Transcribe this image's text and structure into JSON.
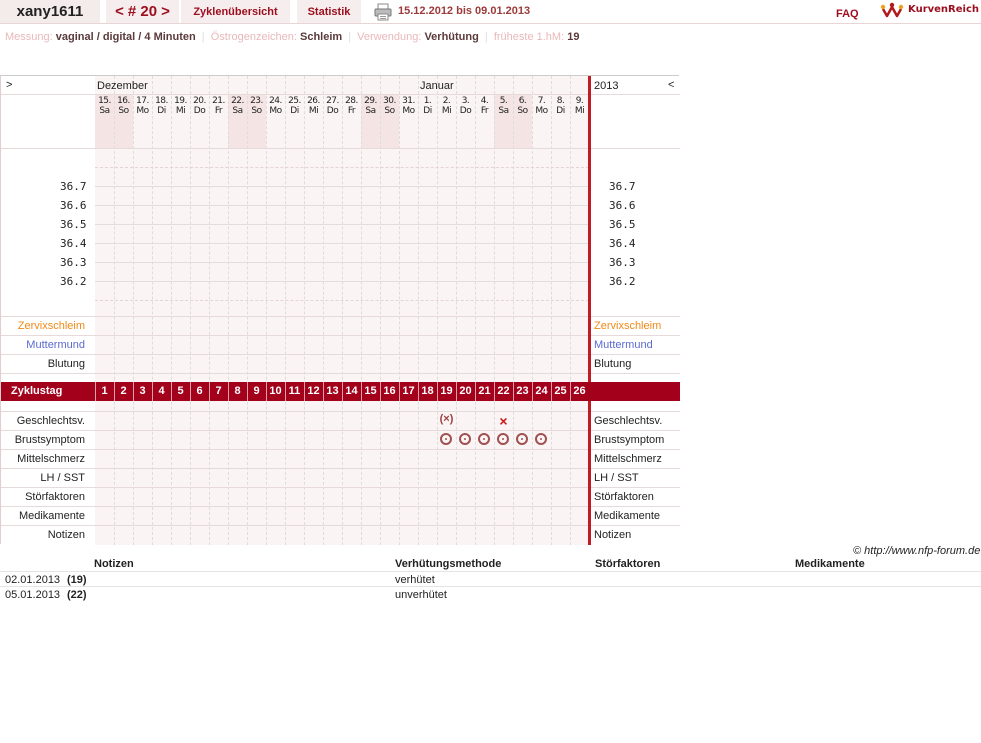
{
  "header": {
    "username": "xany1611",
    "cycle_prev": "<",
    "cycle_label": "# 20",
    "cycle_next": ">",
    "tab_overview": "Zyklenübersicht",
    "tab_stats": "Statistik",
    "date_range": "15.12.2012 bis 09.01.2013",
    "faq": "FAQ",
    "brand": "KurvenReich"
  },
  "info": {
    "measurement_label": "Messung:",
    "measurement_value": "vaginal / digital / 4 Minuten",
    "estrogen_label": "Östrogenzeichen:",
    "estrogen_value": "Schleim",
    "usage_label": "Verwendung:",
    "usage_value": "Verhütung",
    "earliest_label": "früheste 1.hM:",
    "earliest_value": "19"
  },
  "chart": {
    "nav_left": ">",
    "nav_right": "<",
    "month_dec": "Dezember",
    "month_jan": "Januar",
    "year": "2013",
    "days": [
      {
        "d": "15.",
        "w": "Sa"
      },
      {
        "d": "16.",
        "w": "So"
      },
      {
        "d": "17.",
        "w": "Mo"
      },
      {
        "d": "18.",
        "w": "Di"
      },
      {
        "d": "19.",
        "w": "Mi"
      },
      {
        "d": "20.",
        "w": "Do"
      },
      {
        "d": "21.",
        "w": "Fr"
      },
      {
        "d": "22.",
        "w": "Sa"
      },
      {
        "d": "23.",
        "w": "So"
      },
      {
        "d": "24.",
        "w": "Mo"
      },
      {
        "d": "25.",
        "w": "Di"
      },
      {
        "d": "26.",
        "w": "Mi"
      },
      {
        "d": "27.",
        "w": "Do"
      },
      {
        "d": "28.",
        "w": "Fr"
      },
      {
        "d": "29.",
        "w": "Sa"
      },
      {
        "d": "30.",
        "w": "So"
      },
      {
        "d": "31.",
        "w": "Mo"
      },
      {
        "d": "1.",
        "w": "Di"
      },
      {
        "d": "2.",
        "w": "Mi"
      },
      {
        "d": "3.",
        "w": "Do"
      },
      {
        "d": "4.",
        "w": "Fr"
      },
      {
        "d": "5.",
        "w": "Sa"
      },
      {
        "d": "6.",
        "w": "So"
      },
      {
        "d": "7.",
        "w": "Mo"
      },
      {
        "d": "8.",
        "w": "Di"
      },
      {
        "d": "9.",
        "w": "Mi"
      }
    ],
    "temps": [
      "36.7",
      "36.6",
      "36.5",
      "36.4",
      "36.3",
      "36.2"
    ],
    "row_zervix": "Zervixschleim",
    "row_muttermund": "Muttermund",
    "row_blutung": "Blutung",
    "zyklustag": "Zyklustag",
    "cycle_days": [
      "1",
      "2",
      "3",
      "4",
      "5",
      "6",
      "7",
      "8",
      "9",
      "10",
      "11",
      "12",
      "13",
      "14",
      "15",
      "16",
      "17",
      "18",
      "19",
      "20",
      "21",
      "22",
      "23",
      "24",
      "25",
      "26"
    ],
    "row_geschlechtsv": "Geschlechtsv.",
    "row_brust": "Brustsymptom",
    "row_mittel": "Mittelschmerz",
    "row_lh": "LH / SST",
    "row_stoer": "Störfaktoren",
    "row_medi": "Medikamente",
    "row_notizen": "Notizen",
    "intercourse": [
      {
        "day_index": 18,
        "symbol": "(×)"
      },
      {
        "day_index": 21,
        "symbol": "×"
      }
    ],
    "breast_days": [
      18,
      19,
      20,
      21,
      22,
      23
    ],
    "copyright": "© http://www.nfp-forum.de"
  },
  "notes": {
    "col_notes": "Notizen",
    "col_method": "Verhütungsmethode",
    "col_stoer": "Störfaktoren",
    "col_medi": "Medikamente",
    "rows": [
      {
        "date": "02.01.2013",
        "day": "(19)",
        "method": "verhütet"
      },
      {
        "date": "05.01.2013",
        "day": "(22)",
        "method": "unverhütet"
      }
    ]
  }
}
